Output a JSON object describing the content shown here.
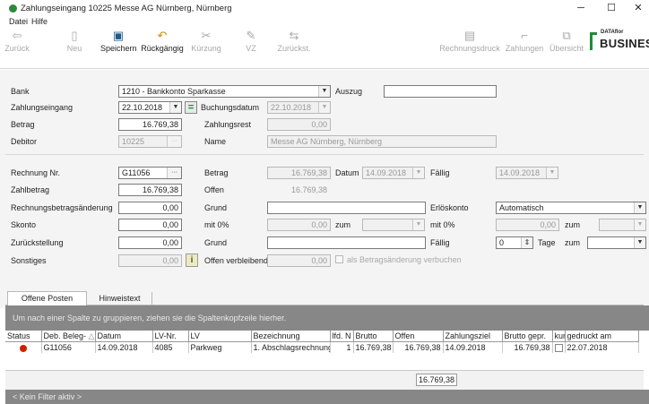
{
  "window": {
    "title": "Zahlungseingang 10225 Messe AG Nürnberg, Nürnberg",
    "menu": [
      "Datei",
      "Hilfe"
    ]
  },
  "toolbar": {
    "left": [
      {
        "label": "Zurück",
        "icon": "arrow-left-icon",
        "enabled": false
      },
      {
        "label": "Neu",
        "icon": "new-document-icon",
        "enabled": false
      },
      {
        "label": "Speichern",
        "icon": "save-icon",
        "enabled": true
      },
      {
        "label": "Rückgängig",
        "icon": "undo-icon",
        "enabled": true
      },
      {
        "label": "Kürzung",
        "icon": "scissors-icon",
        "enabled": false
      },
      {
        "label": "VZ",
        "icon": "edit-icon",
        "enabled": false
      },
      {
        "label": "Zurückst.",
        "icon": "reset-icon",
        "enabled": false
      }
    ],
    "right": [
      {
        "label": "Rechnungsdruck",
        "icon": "print-icon",
        "enabled": false
      },
      {
        "label": "Zahlungen",
        "icon": "payments-icon",
        "enabled": false
      },
      {
        "label": "Übersicht",
        "icon": "overview-icon",
        "enabled": false
      }
    ],
    "brand_small": "DATAflor",
    "brand_large": "BUSINESS",
    "brand_color": "#1e8c3c"
  },
  "top_form": {
    "bank_label": "Bank",
    "bank_value": "1210 - Bankkonto Sparkasse",
    "auszug_label": "Auszug",
    "auszug_value": "",
    "zahlungseingang_label": "Zahlungseingang",
    "zahlungseingang_value": "22.10.2018",
    "equal_sign": "=",
    "buchungsdatum_label": "Buchungsdatum",
    "buchungsdatum_value": "22.10.2018",
    "betrag_label": "Betrag",
    "betrag_value": "16.769,38",
    "zahlungsrest_label": "Zahlungsrest",
    "zahlungsrest_value": "0,00",
    "debitor_label": "Debitor",
    "debitor_value": "10225",
    "name_label": "Name",
    "name_value": "Messe AG Nürnberg, Nürnberg"
  },
  "invoice_form": {
    "rechnung_label": "Rechnung Nr.",
    "rechnung_value": "G11056",
    "betrag_label": "Betrag",
    "betrag_value": "16.769,38",
    "datum_label": "Datum",
    "datum_value": "14.09.2018",
    "faellig_label": "Fällig",
    "faellig_value": "14.09.2018",
    "zahlbetrag_label": "Zahlbetrag",
    "zahlbetrag_value": "16.769,38",
    "offen_label": "Offen",
    "offen_value": "16.769,38",
    "rbaenderung_label": "Rechnungsbetragsänderung",
    "rbaenderung_value": "0,00",
    "grund1_label": "Grund",
    "grund1_value": "",
    "erloeskonto_label": "Erlöskonto",
    "erloeskonto_value": "Automatisch",
    "skonto_label": "Skonto",
    "skonto_value": "0,00",
    "mit0_1_label": "mit 0%",
    "skonto_mit0_value": "0,00",
    "zum1_label": "zum",
    "zum1_value": "",
    "mit0_2_label": "mit 0%",
    "mit0_2_value": "0,00",
    "zum2_label": "zum",
    "zum2_value": "",
    "zurueckstellung_label": "Zurückstellung",
    "zurueckstellung_value": "0,00",
    "grund2_label": "Grund",
    "grund2_value": "",
    "faellig2_label": "Fällig",
    "tage_value": "0",
    "tage_label": "Tage",
    "zum3_label": "zum",
    "zum3_value": "",
    "sonstiges_label": "Sonstiges",
    "sonstiges_value": "0,00",
    "offen_verbleibend_label": "Offen verbleibend",
    "offen_verbleibend_value": "0,00",
    "checkbox_label": "als Betragsänderung verbuchen"
  },
  "tabs": [
    "Offene Posten",
    "Hinweistext Belegdruck"
  ],
  "grid": {
    "group_hint": "Um nach einer Spalte zu gruppieren, ziehen sie die Spaltenkopfzeile hierher.",
    "columns": [
      "Status",
      "Deb. Beleg-",
      "Datum",
      "LV-Nr.",
      "LV",
      "Bezeichnung",
      "lfd. N",
      "Brutto",
      "Offen",
      "Zahlungsziel",
      "Brutto gepr.",
      "kur",
      "gedruckt am"
    ],
    "rows": [
      {
        "status_color": "#cc2200",
        "beleg": "G11056",
        "datum": "14.09.2018",
        "lvnr": "4085",
        "lv": "Parkweg",
        "bezeichnung": "1. Abschlagsrechnung",
        "lfd": "1",
        "brutto": "16.769,38",
        "offen": "16.769,38",
        "zahlungsziel": "14.09.2018",
        "brutto_gepr": "16.769,38",
        "kur": "",
        "gedruckt": "22.07.2018"
      }
    ],
    "sum_offen": "16.769,38",
    "filter_text": "< Kein Filter aktiv >"
  }
}
